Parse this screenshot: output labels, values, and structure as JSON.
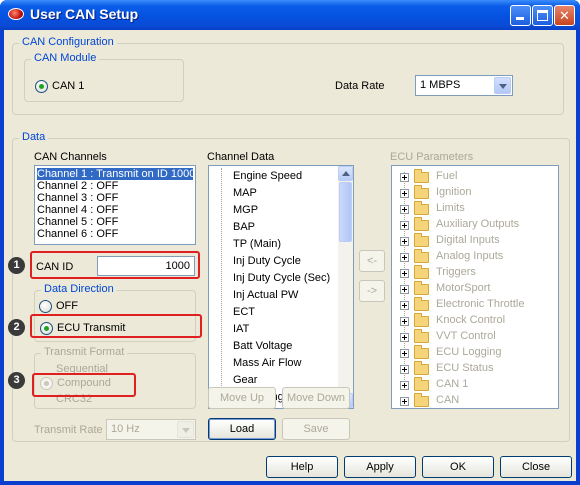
{
  "window": {
    "title": "User CAN Setup"
  },
  "can_configuration": {
    "label": "CAN Configuration",
    "can_module": {
      "label": "CAN Module",
      "option": "CAN 1",
      "checked": true
    },
    "data_rate": {
      "label": "Data Rate",
      "value": "1 MBPS"
    }
  },
  "data": {
    "label": "Data",
    "can_channels": {
      "label": "CAN Channels",
      "items": [
        "Channel 1 : Transmit on ID 1000",
        "Channel 2 : OFF",
        "Channel 3 : OFF",
        "Channel 4 : OFF",
        "Channel 5 : OFF",
        "Channel 6 : OFF"
      ],
      "selected_index": 0
    },
    "can_id": {
      "label": "CAN ID",
      "value": "1000"
    },
    "data_direction": {
      "label": "Data Direction",
      "options": [
        "OFF",
        "ECU Transmit"
      ],
      "selected": "ECU Transmit"
    },
    "transmit_format": {
      "label": "Transmit Format",
      "options": [
        "Sequential",
        "Compound",
        "CRC32"
      ],
      "selected": "Compound"
    },
    "transmit_rate": {
      "label": "Transmit Rate",
      "value": "10 Hz"
    },
    "channel_data": {
      "label": "Channel Data",
      "items": [
        "Engine Speed",
        "MAP",
        "MGP",
        "BAP",
        "TP (Main)",
        "Inj Duty Cycle",
        "Inj Duty Cycle (Sec)",
        "Inj Actual PW",
        "ECT",
        "IAT",
        "Batt Voltage",
        "Mass Air Flow",
        "Gear",
        "Ign Timing"
      ]
    },
    "transfer_buttons": {
      "remove": "<-",
      "add": "->"
    },
    "ecu_parameters": {
      "label": "ECU Parameters",
      "items": [
        "Fuel",
        "Ignition",
        "Limits",
        "Auxiliary Outputs",
        "Digital Inputs",
        "Analog Inputs",
        "Triggers",
        "MotorSport",
        "Electronic Throttle",
        "Knock Control",
        "VVT Control",
        "ECU Logging",
        "ECU Status",
        "CAN 1",
        "CAN"
      ]
    },
    "buttons": {
      "move_up": "Move Up",
      "move_down": "Move Down",
      "load": "Load",
      "save": "Save"
    }
  },
  "footer": {
    "help": "Help",
    "apply": "Apply",
    "ok": "OK",
    "close": "Close"
  },
  "callouts": [
    "1",
    "2",
    "3"
  ]
}
